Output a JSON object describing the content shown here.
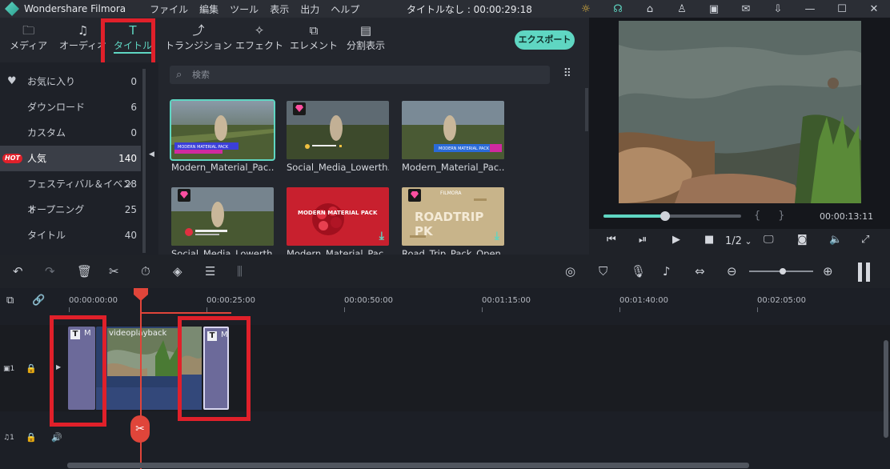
{
  "app": {
    "name": "Wondershare Filmora",
    "menu": [
      "ファイル",
      "編集",
      "ツール",
      "表示",
      "出力",
      "ヘルプ"
    ],
    "document_title": "タイトルなし : 00:00:29:18"
  },
  "tabs": [
    {
      "label": "メディア",
      "icon": "folder-icon"
    },
    {
      "label": "オーディオ",
      "icon": "music-note-icon"
    },
    {
      "label": "タイトル",
      "icon": "text-t-icon",
      "active": true
    },
    {
      "label": "トランジション",
      "icon": "transition-icon"
    },
    {
      "label": "エフェクト",
      "icon": "effects-icon"
    },
    {
      "label": "エレメント",
      "icon": "elements-icon"
    },
    {
      "label": "分割表示",
      "icon": "split-screen-icon"
    }
  ],
  "export_label": "エクスポート",
  "sidebar": {
    "items": [
      {
        "label": "お気に入り",
        "count": "0"
      },
      {
        "label": "ダウンロード",
        "count": "6"
      },
      {
        "label": "カスタム",
        "count": "0"
      },
      {
        "label": "人気",
        "count": "140",
        "badge": "HOT",
        "selected": true
      },
      {
        "label": "フェスティバル＆イベント",
        "count": "28"
      },
      {
        "label": "オープニング",
        "count": "25"
      },
      {
        "label": "タイトル",
        "count": "40"
      }
    ]
  },
  "search": {
    "placeholder": "検索"
  },
  "gallery": [
    {
      "caption": "Modern_Material_Pac...",
      "selected": true
    },
    {
      "caption": "Social_Media_Lowerth...",
      "premium": true
    },
    {
      "caption": "Modern_Material_Pac..."
    },
    {
      "caption": "Social_Media_Lowerth...",
      "premium": true
    },
    {
      "caption": "Modern_Material_Pac...",
      "download": true,
      "thumb_text": "MODERN MATERIAL PACK"
    },
    {
      "caption": "Road_Trip_Pack_Open...",
      "premium": true,
      "download": true,
      "thumb_text": "ROADTRIP PK",
      "thumb_brand": "FILMORA"
    }
  ],
  "preview": {
    "time": "00:00:13:11",
    "progress": 0.45,
    "quality": "1/2"
  },
  "timeline": {
    "ruler": [
      "00:00:00:00",
      "00:00:25:00",
      "00:00:50:00",
      "00:01:15:00",
      "00:01:40:00",
      "00:02:05:00"
    ],
    "track1_label": "1",
    "track2_label": "1",
    "video_clip_name": "videoplayback",
    "title_clip_letter": "M"
  },
  "colors": {
    "accent": "#5fd6c2",
    "highlight_red": "#e0202a",
    "playhead": "#e0453a",
    "title_clip": "#6c6a9a",
    "video_clip": "#2a3f6b"
  }
}
